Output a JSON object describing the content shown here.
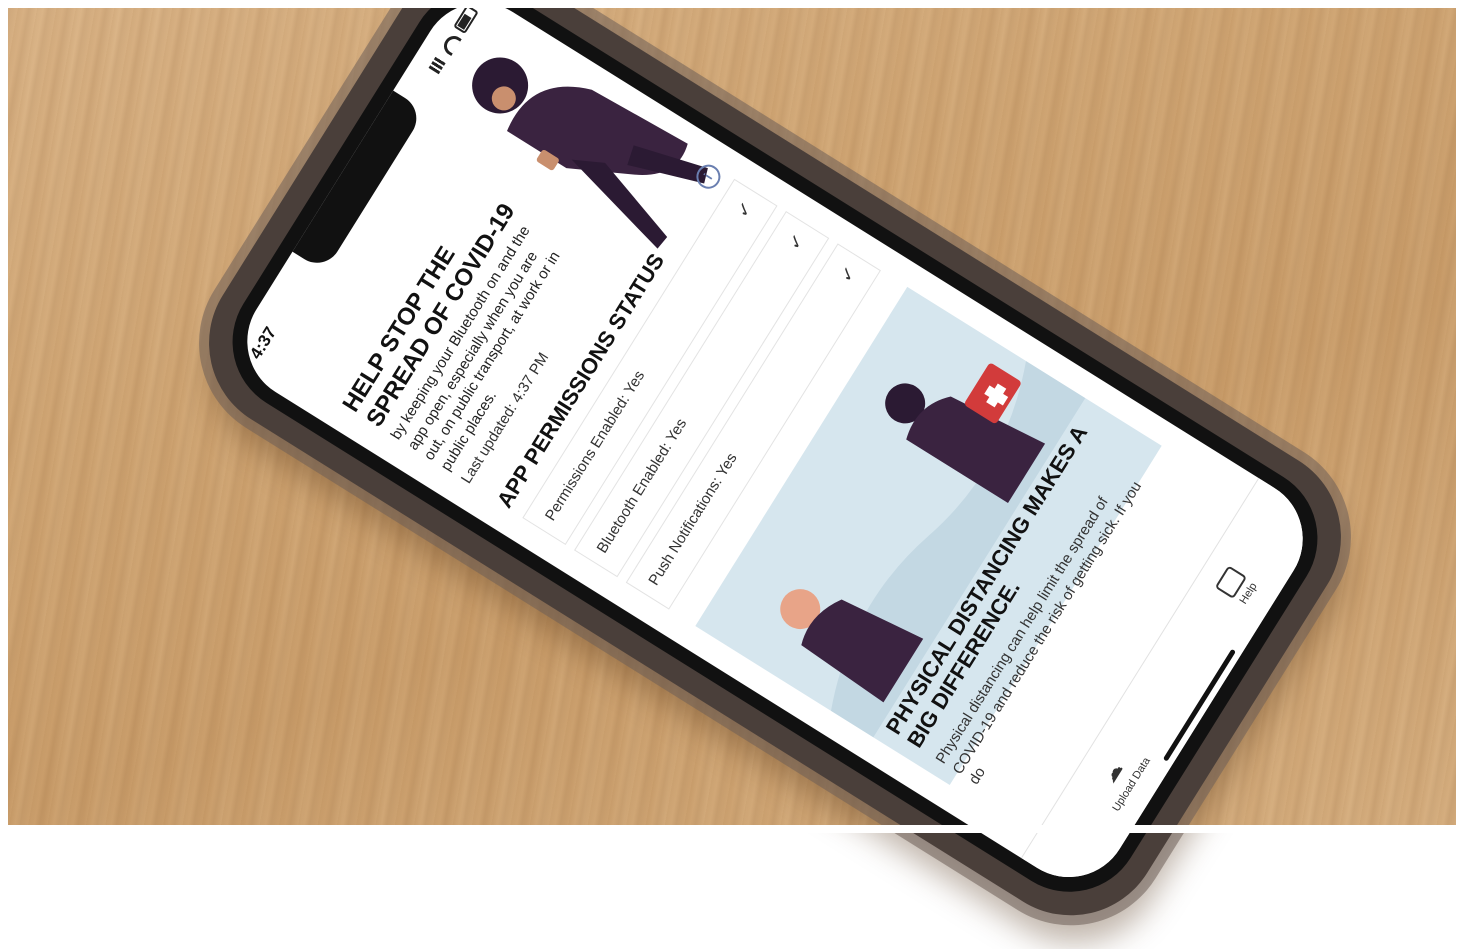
{
  "status_bar": {
    "time": "4:37"
  },
  "hero": {
    "title": "HELP STOP THE SPREAD OF COVID-19",
    "body": "by keeping your Bluetooth on and the app open, especially when you are out, on public transport, at work or in public places.",
    "last_updated": "Last updated: 4:37 PM"
  },
  "permissions": {
    "title": "APP PERMISSIONS STATUS",
    "rows": [
      {
        "label": "Permissions Enabled: Yes"
      },
      {
        "label": "Bluetooth Enabled: Yes"
      },
      {
        "label": "Push Notifications: Yes"
      }
    ]
  },
  "card": {
    "title": "PHYSICAL DISTANCING MAKES A BIG DIFFERENCE.",
    "body": "Physical distancing can help limit the spread of COVID-19 and reduce the risk of getting sick. If you do"
  },
  "tab_bar": {
    "upload_label": "Upload Data",
    "help_label": "Help"
  },
  "colors": {
    "table": "#cfa472",
    "phone_case": "#4a3f3a",
    "figure": "#3a2340",
    "card_bg": "#d6e6ee",
    "info_accent": "#6a7fb0"
  }
}
